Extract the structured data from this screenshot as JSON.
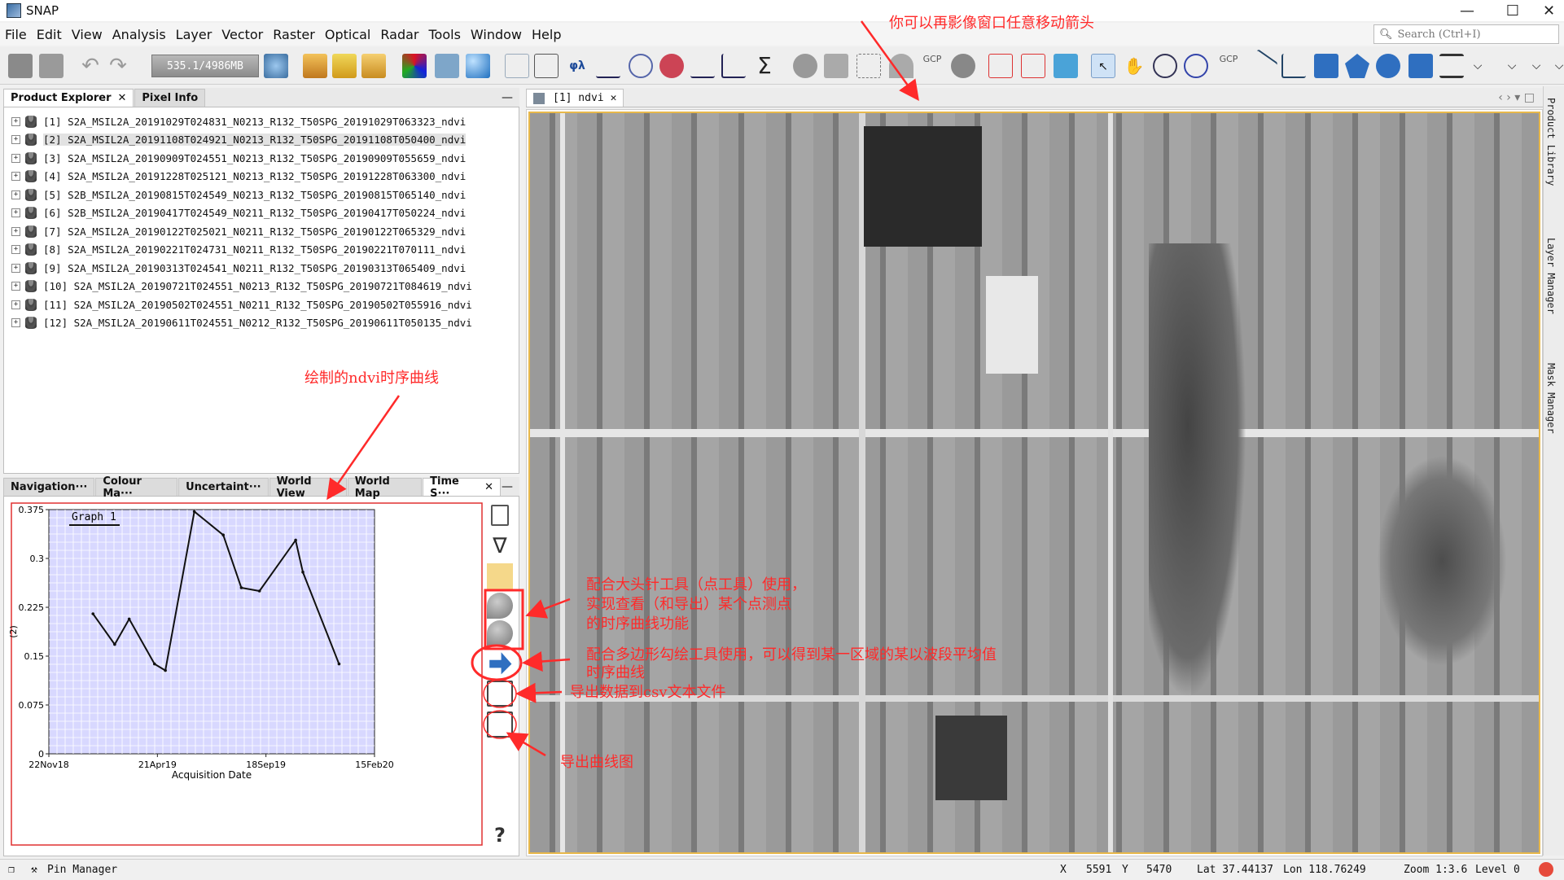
{
  "window": {
    "title": "SNAP",
    "minimize": "—",
    "maximize": "☐",
    "close": "✕"
  },
  "menu": [
    "File",
    "Edit",
    "View",
    "Analysis",
    "Layer",
    "Vector",
    "Raster",
    "Optical",
    "Radar",
    "Tools",
    "Window",
    "Help"
  ],
  "search": {
    "placeholder": "Search (Ctrl+I)"
  },
  "toolbar": {
    "memory": "535.1/4986MB"
  },
  "product_explorer": {
    "tabs": [
      "Product Explorer",
      "Pixel Info"
    ],
    "items": [
      "[1] S2A_MSIL2A_20191029T024831_N0213_R132_T50SPG_20191029T063323_ndvi",
      "[2] S2A_MSIL2A_20191108T024921_N0213_R132_T50SPG_20191108T050400_ndvi",
      "[3] S2A_MSIL2A_20190909T024551_N0213_R132_T50SPG_20190909T055659_ndvi",
      "[4] S2A_MSIL2A_20191228T025121_N0213_R132_T50SPG_20191228T063300_ndvi",
      "[5] S2B_MSIL2A_20190815T024549_N0213_R132_T50SPG_20190815T065140_ndvi",
      "[6] S2B_MSIL2A_20190417T024549_N0211_R132_T50SPG_20190417T050224_ndvi",
      "[7] S2A_MSIL2A_20190122T025021_N0211_R132_T50SPG_20190122T065329_ndvi",
      "[8] S2A_MSIL2A_20190221T024731_N0211_R132_T50SPG_20190221T070111_ndvi",
      "[9] S2A_MSIL2A_20190313T024541_N0211_R132_T50SPG_20190313T065409_ndvi",
      "[10] S2A_MSIL2A_20190721T024551_N0213_R132_T50SPG_20190721T084619_ndvi",
      "[11] S2A_MSIL2A_20190502T024551_N0211_R132_T50SPG_20190502T055916_ndvi",
      "[12] S2A_MSIL2A_20190611T024551_N0212_R132_T50SPG_20190611T050135_ndvi"
    ]
  },
  "bottom_tabs": [
    "Navigation···",
    "Colour Ma···",
    "Uncertaint···",
    "World View",
    "World Map",
    "Time S···"
  ],
  "image_view": {
    "tab_label": "[1] ndvi"
  },
  "right_sidebar": [
    "Product Library",
    "Layer Manager",
    "Mask Manager"
  ],
  "annotations": {
    "move_arrow": "你可以再影像窗口任意移动箭头",
    "curve_label": "绘制的ndvi时序曲线",
    "pin_tool_1": "配合大头针工具（点工具）使用，",
    "pin_tool_2": "实现查看（和导出）某个点测点",
    "pin_tool_3": "的时序曲线功能",
    "polygon_tool_1": "配合多边形勾绘工具使用，可以得到某一区域的某以波段平均值",
    "polygon_tool_2": "时序曲线",
    "export_csv": "导出数据到csv文本文件",
    "export_chart": "导出曲线图"
  },
  "chart_data": {
    "type": "line",
    "title": "Graph 1",
    "xlabel": "Acquisition Date",
    "ylabel": "(2)",
    "x_tick_labels": [
      "22Nov18",
      "21Apr19",
      "18Sep19",
      "15Feb20"
    ],
    "y_tick_labels": [
      "0",
      "0.075",
      "0.15",
      "0.225",
      "0.3",
      "0.375"
    ],
    "ylim": [
      0,
      0.375
    ],
    "xlim": [
      "2018-11-22",
      "2020-02-15"
    ],
    "series": [
      {
        "name": "Graph 1",
        "x": [
          "2019-01-22",
          "2019-02-21",
          "2019-03-13",
          "2019-04-17",
          "2019-05-02",
          "2019-06-11",
          "2019-07-21",
          "2019-08-15",
          "2019-09-09",
          "2019-10-29",
          "2019-11-08",
          "2019-12-28"
        ],
        "values": [
          0.215,
          0.168,
          0.207,
          0.138,
          0.128,
          0.372,
          0.336,
          0.255,
          0.25,
          0.328,
          0.279,
          0.138
        ]
      }
    ],
    "grid": true,
    "background": "#d8d8ff"
  },
  "status": {
    "pin_manager": "Pin Manager",
    "x_label": "X",
    "x_value": "5591",
    "y_label": "Y",
    "y_value": "5470",
    "lat": "Lat 37.44137",
    "lon": "Lon 118.76249",
    "zoom": "Zoom 1:3.6",
    "level": "Level 0"
  },
  "colors": {
    "annotation": "#ff2a2a",
    "chart_bg": "#d8d8ff",
    "select_border": "#e8b84a"
  }
}
